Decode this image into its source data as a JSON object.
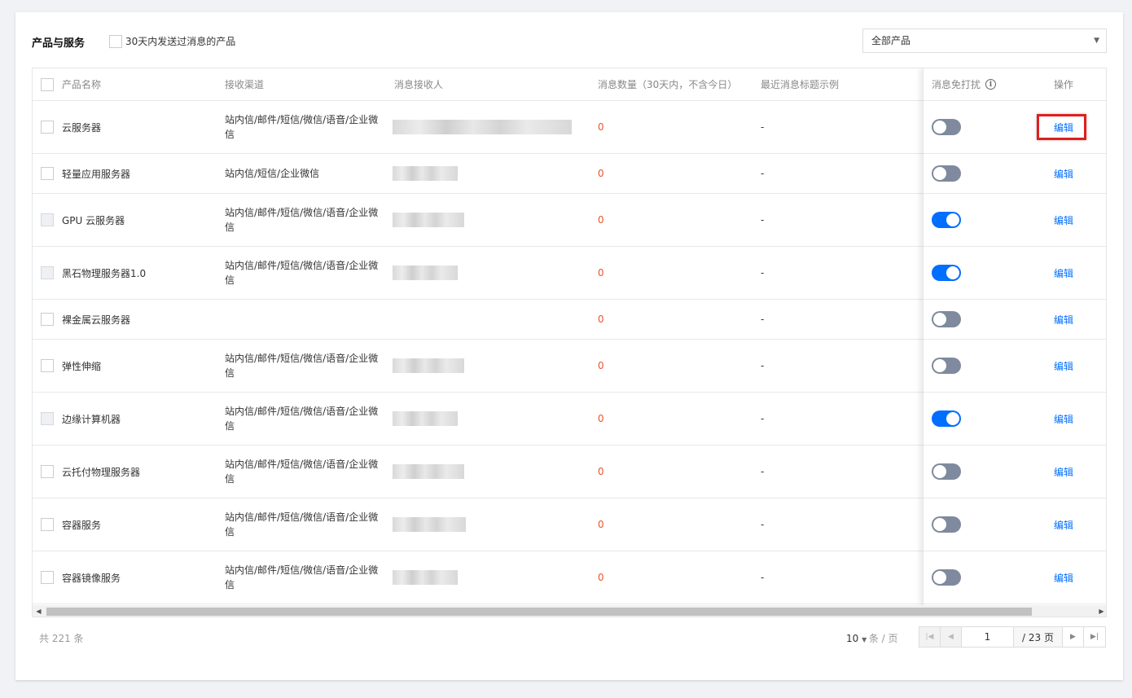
{
  "header": {
    "title": "产品与服务",
    "filter_label": "30天内发送过消息的产品",
    "select_value": "全部产品"
  },
  "columns": {
    "name": "产品名称",
    "channel": "接收渠道",
    "receiver": "消息接收人",
    "count": "消息数量（30天内，不含今日）",
    "sample": "最近消息标题示例",
    "dnd": "消息免打扰",
    "op": "操作"
  },
  "rows": [
    {
      "name": "云服务器",
      "channel": "站内信/邮件/短信/微信/语音/企业微信",
      "count": "0",
      "sample": "-",
      "dnd": false,
      "op": "编辑"
    },
    {
      "name": "轻量应用服务器",
      "channel": "站内信/短信/企业微信",
      "count": "0",
      "sample": "-",
      "dnd": false,
      "op": "编辑"
    },
    {
      "name": "GPU 云服务器",
      "channel": "站内信/邮件/短信/微信/语音/企业微信",
      "count": "0",
      "sample": "-",
      "dnd": true,
      "op": "编辑"
    },
    {
      "name": "黑石物理服务器1.0",
      "channel": "站内信/邮件/短信/微信/语音/企业微信",
      "count": "0",
      "sample": "-",
      "dnd": true,
      "op": "编辑"
    },
    {
      "name": "裸金属云服务器",
      "channel": "",
      "count": "0",
      "sample": "-",
      "dnd": false,
      "op": "编辑"
    },
    {
      "name": "弹性伸缩",
      "channel": "站内信/邮件/短信/微信/语音/企业微信",
      "count": "0",
      "sample": "-",
      "dnd": false,
      "op": "编辑"
    },
    {
      "name": "边缘计算机器",
      "channel": "站内信/邮件/短信/微信/语音/企业微信",
      "count": "0",
      "sample": "-",
      "dnd": true,
      "op": "编辑"
    },
    {
      "name": "云托付物理服务器",
      "channel": "站内信/邮件/短信/微信/语音/企业微信",
      "count": "0",
      "sample": "-",
      "dnd": false,
      "op": "编辑"
    },
    {
      "name": "容器服务",
      "channel": "站内信/邮件/短信/微信/语音/企业微信",
      "count": "0",
      "sample": "-",
      "dnd": false,
      "op": "编辑"
    },
    {
      "name": "容器镜像服务",
      "channel": "站内信/邮件/短信/微信/语音/企业微信",
      "count": "0",
      "sample": "-",
      "dnd": false,
      "op": "编辑"
    }
  ],
  "footer": {
    "total": "共 221 条",
    "page_size": "10",
    "page_size_unit": "条 / 页",
    "current_page": "1",
    "total_pages": "/ 23 页"
  },
  "colors": {
    "accent": "#006eff",
    "count": "#e8562a",
    "highlight": "#e01e1e"
  }
}
